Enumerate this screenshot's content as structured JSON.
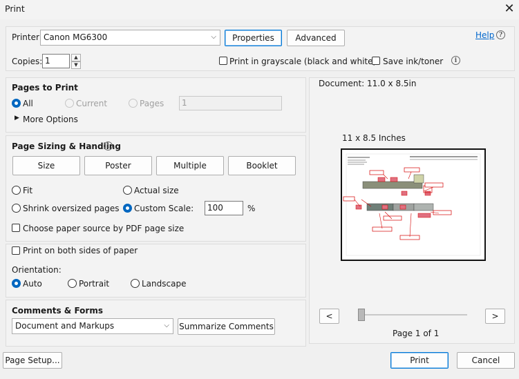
{
  "window": {
    "title": "Print"
  },
  "printer": {
    "label": "Printer:",
    "selected": "Canon MG6300",
    "properties_label": "Properties",
    "advanced_label": "Advanced",
    "help_label": "Help"
  },
  "copies": {
    "label": "Copies:",
    "value": "1",
    "grayscale_label": "Print in grayscale (black and white)",
    "grayscale_checked": false,
    "save_ink_label": "Save ink/toner",
    "save_ink_checked": false
  },
  "pages_to_print": {
    "title": "Pages to Print",
    "all_label": "All",
    "current_label": "Current",
    "pages_label": "Pages",
    "pages_value": "1",
    "selected": "All",
    "more_options_label": "More Options"
  },
  "page_sizing": {
    "title": "Page Sizing & Handling",
    "tabs": [
      "Size",
      "Poster",
      "Multiple",
      "Booklet"
    ],
    "fit_label": "Fit",
    "actual_size_label": "Actual size",
    "shrink_label": "Shrink oversized pages",
    "custom_scale_label": "Custom Scale:",
    "custom_scale_value": "100",
    "percent_symbol": "%",
    "selected": "Custom Scale:",
    "paper_source_label": "Choose paper source by PDF page size",
    "paper_source_checked": false
  },
  "duplex": {
    "both_sides_label": "Print on both sides of paper",
    "both_sides_checked": false,
    "orientation_label": "Orientation:",
    "auto_label": "Auto",
    "portrait_label": "Portrait",
    "landscape_label": "Landscape",
    "selected": "Auto"
  },
  "comments_forms": {
    "title": "Comments & Forms",
    "selected": "Document and Markups",
    "summarize_label": "Summarize Comments"
  },
  "preview": {
    "document_size": "Document: 11.0 x 8.5in",
    "paper_size": "11 x 8.5 Inches",
    "prev_label": "<",
    "next_label": ">",
    "page_status": "Page 1 of 1"
  },
  "footer": {
    "page_setup_label": "Page Setup...",
    "print_label": "Print",
    "cancel_label": "Cancel"
  },
  "colors": {
    "accent": "#0067c0",
    "link": "#0066cc",
    "markup_red": "#d40000"
  }
}
